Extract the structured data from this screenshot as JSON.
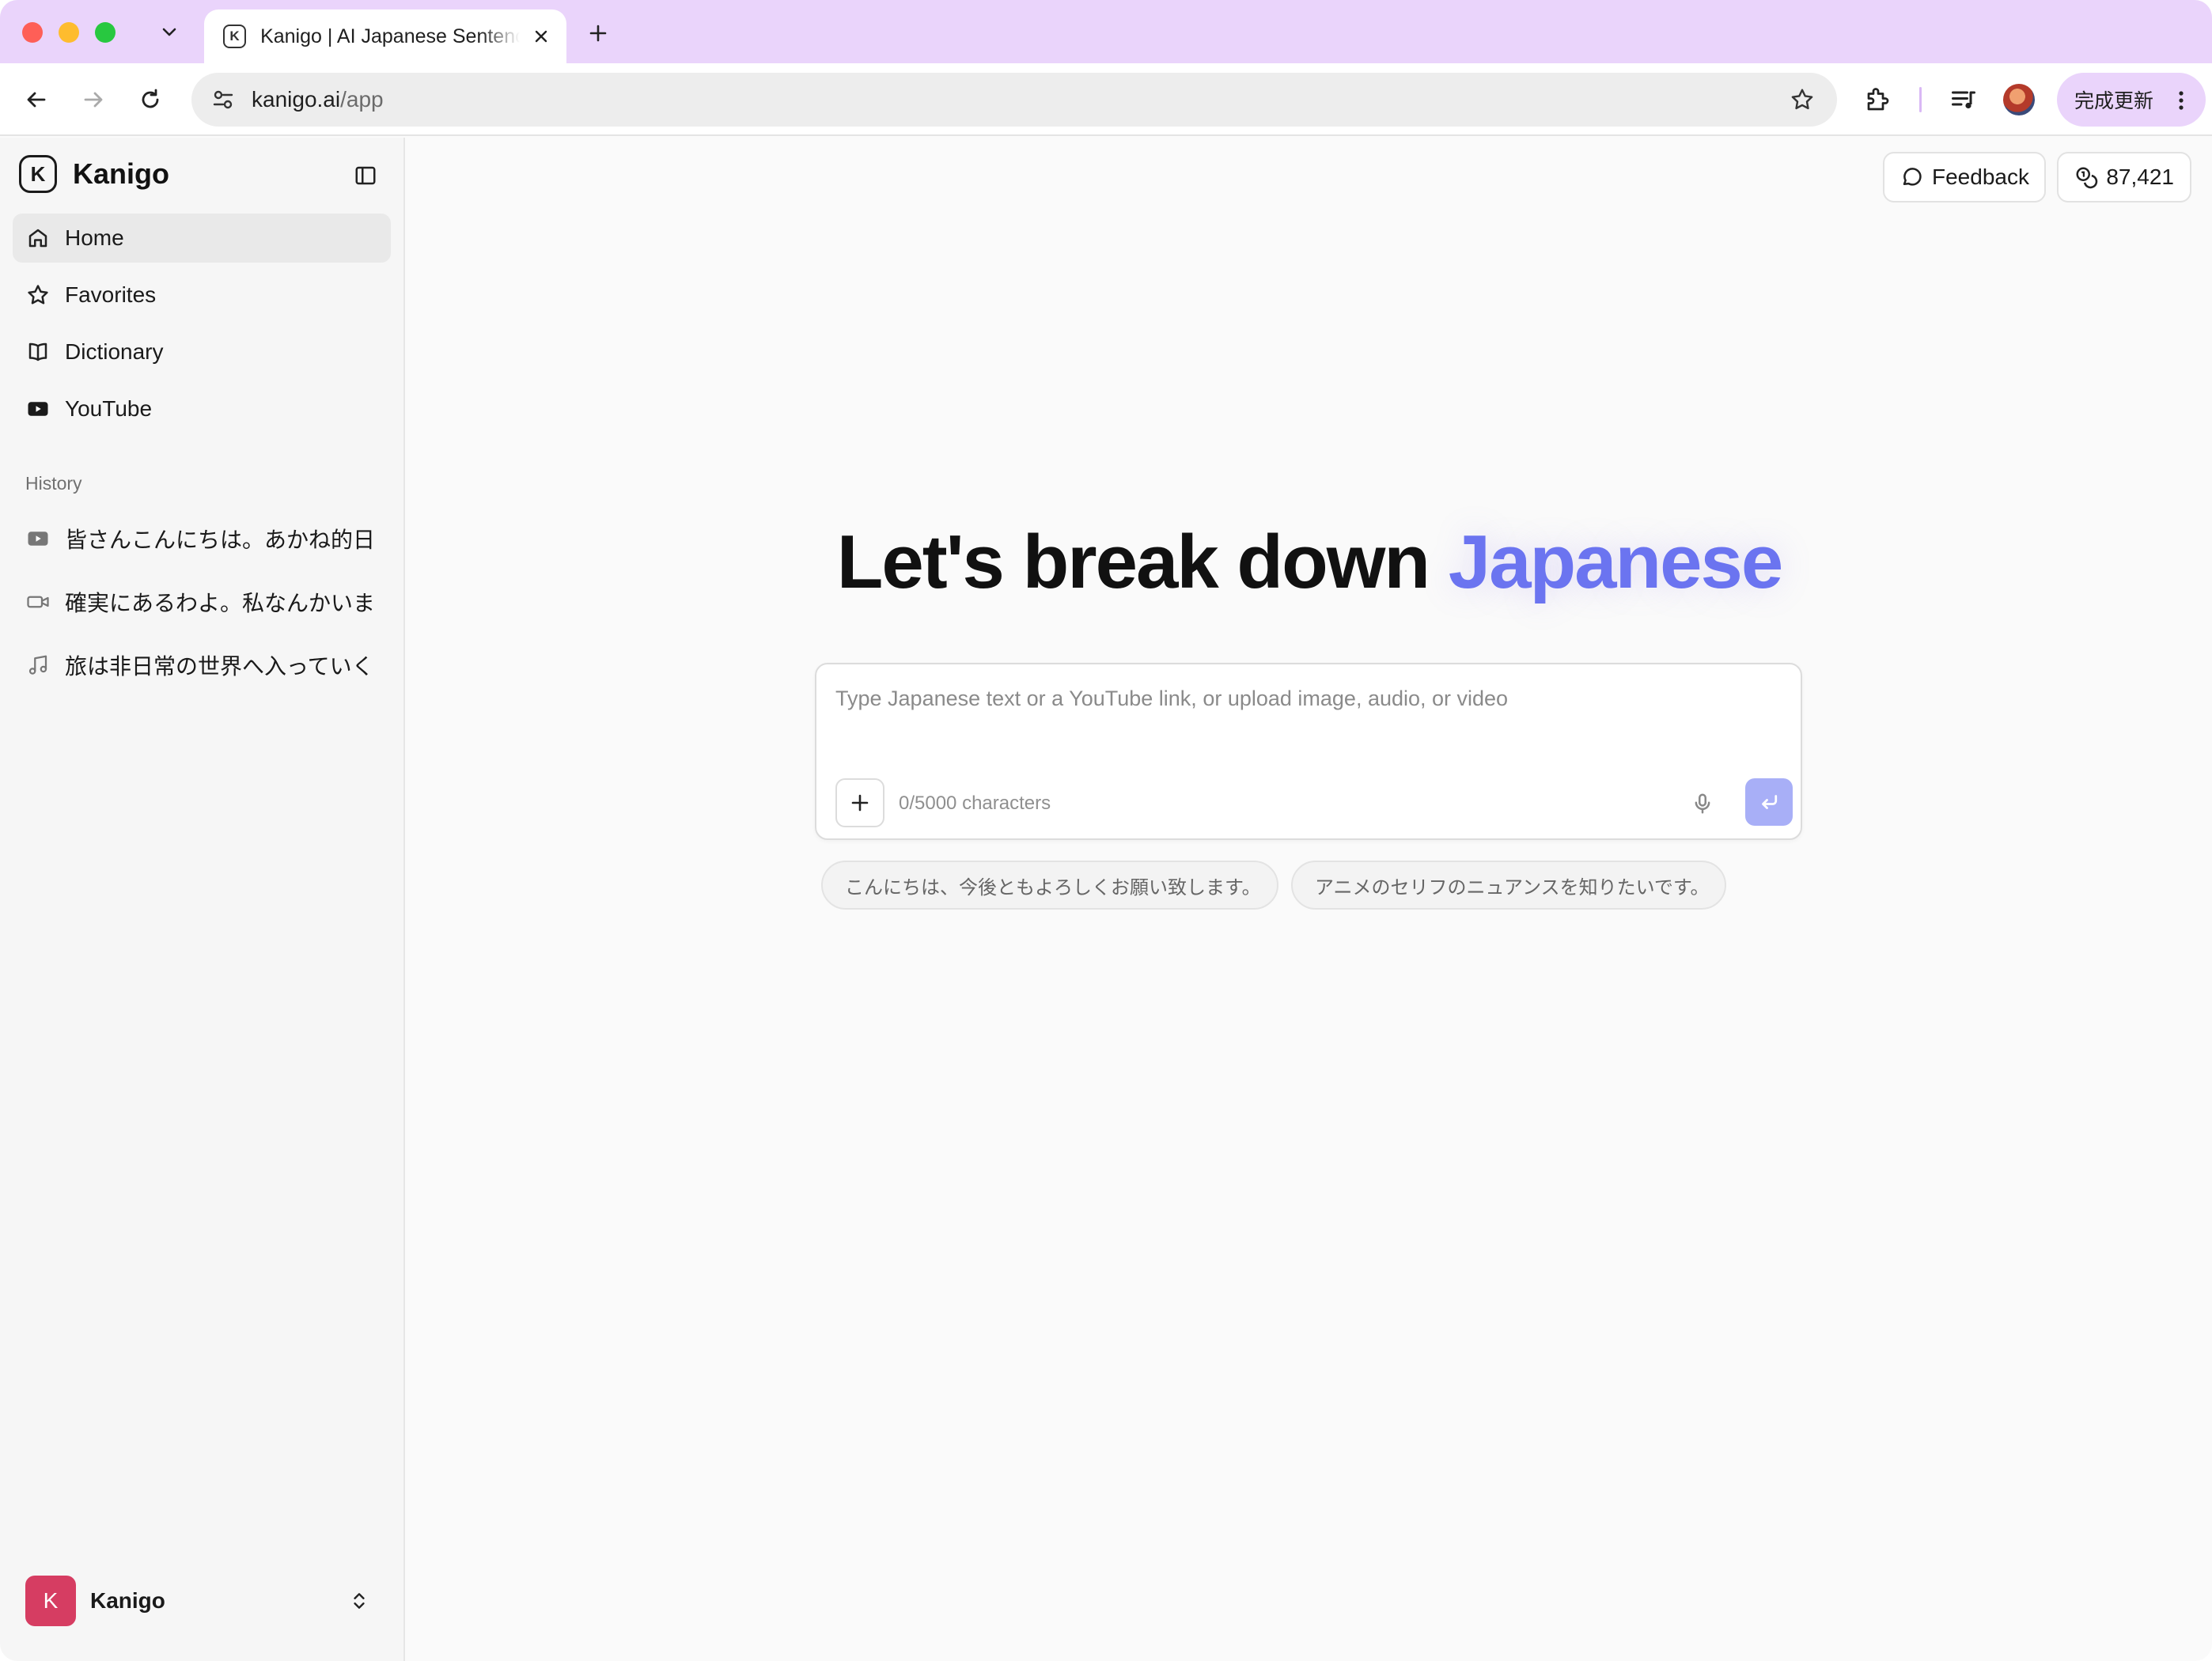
{
  "browser": {
    "tab_title": "Kanigo | AI Japanese Sentence Breakdown",
    "tab_favicon_letter": "K",
    "url_domain": "kanigo.ai",
    "url_path": "/app",
    "update_button_label": "完成更新"
  },
  "sidebar": {
    "brand_letter": "K",
    "brand_name": "Kanigo",
    "nav": [
      {
        "label": "Home",
        "icon": "home-icon",
        "active": true
      },
      {
        "label": "Favorites",
        "icon": "star-icon",
        "active": false
      },
      {
        "label": "Dictionary",
        "icon": "book-icon",
        "active": false
      },
      {
        "label": "YouTube",
        "icon": "youtube-icon",
        "active": false
      }
    ],
    "history_label": "History",
    "history": [
      {
        "label": "皆さんこんにちは。あかね的日",
        "icon": "youtube-icon"
      },
      {
        "label": "確実にあるわよ。私なんかいま",
        "icon": "video-icon"
      },
      {
        "label": "旅は非日常の世界へ入っていく",
        "icon": "music-icon"
      }
    ],
    "account": {
      "avatar_letter": "K",
      "name": "Kanigo"
    }
  },
  "header": {
    "feedback_label": "Feedback",
    "credits_value": "87,421"
  },
  "hero": {
    "title_main": "Let's break down",
    "title_accent": "Japanese"
  },
  "composer": {
    "placeholder": "Type Japanese text or a YouTube link, or upload image, audio, or video",
    "char_count": "0/5000 characters"
  },
  "suggestions": [
    "こんにちは、今後ともよろしくお願い致します。",
    "アニメのセリフのニュアンスを知りたいです。"
  ],
  "colors": {
    "accent": "#6b74f0",
    "send_button": "#a8aff7",
    "tabbar": "#ead4fb",
    "account_avatar": "#d63d62"
  }
}
